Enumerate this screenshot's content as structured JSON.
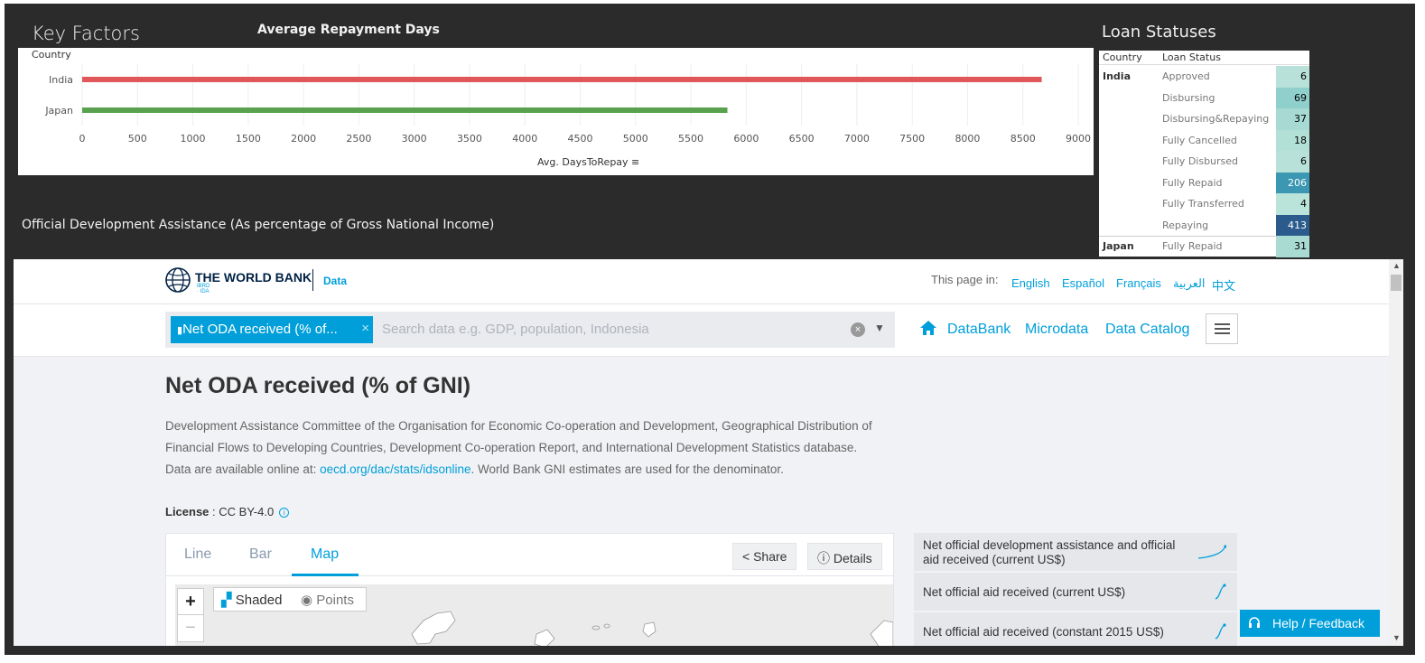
{
  "dashboard": {
    "key_factors_title": "Key Factors",
    "bar_chart_title": "Average Repayment Days",
    "loan_title": "Loan Statuses",
    "oda_title": "Official Development Assistance (As percentage of Gross National Income)"
  },
  "chart_data": {
    "type": "bar",
    "orientation": "horizontal",
    "title": "Average Repayment Days",
    "ylabel": "Country",
    "xlabel": "Avg. DaysToRepay",
    "categories": [
      "India",
      "Japan"
    ],
    "values": [
      8670,
      5830
    ],
    "colors": [
      "#e15759",
      "#59a14f"
    ],
    "xlim": [
      0,
      9000
    ],
    "xticks": [
      0,
      500,
      1000,
      1500,
      2000,
      2500,
      3000,
      3500,
      4000,
      4500,
      5000,
      5500,
      6000,
      6500,
      7000,
      7500,
      8000,
      8500,
      9000
    ],
    "grid": true
  },
  "loan_table": {
    "headers": [
      "Country",
      "Loan Status"
    ],
    "rows": [
      {
        "country": "India",
        "status": "Approved",
        "value": "6",
        "bg": "#b8e2d9",
        "fg": "#000"
      },
      {
        "country": "",
        "status": "Disbursing",
        "value": "69",
        "bg": "#8fcfcc",
        "fg": "#000"
      },
      {
        "country": "",
        "status": "Disbursing&Repaying",
        "value": "37",
        "bg": "#a6dad2",
        "fg": "#000"
      },
      {
        "country": "",
        "status": "Fully Cancelled",
        "value": "18",
        "bg": "#b2dfd6",
        "fg": "#000"
      },
      {
        "country": "",
        "status": "Fully Disbursed",
        "value": "6",
        "bg": "#b8e2d9",
        "fg": "#000"
      },
      {
        "country": "",
        "status": "Fully Repaid",
        "value": "206",
        "bg": "#3b97b2",
        "fg": "#fff"
      },
      {
        "country": "",
        "status": "Fully Transferred",
        "value": "4",
        "bg": "#bae3da",
        "fg": "#000"
      },
      {
        "country": "",
        "status": "Repaying",
        "value": "413",
        "bg": "#2b5a8c",
        "fg": "#fff"
      },
      {
        "country": "Japan",
        "status": "Fully Repaid",
        "value": "31",
        "bg": "#a9dbd3",
        "fg": "#000"
      }
    ]
  },
  "web": {
    "logo_text": "THE WORLD BANK",
    "logo_sub": "IBRD · IDA",
    "logo_data": "Data",
    "lang_label": "This page in:",
    "languages": [
      "English",
      "Español",
      "Français",
      "العربية",
      "中文"
    ],
    "search_chip": "Net ODA received (% of...",
    "search_placeholder": "Search data e.g. GDP, population, Indonesia",
    "nav": [
      "DataBank",
      "Microdata",
      "Data Catalog"
    ],
    "page_title": "Net ODA received (% of GNI)",
    "desc_before": "Development Assistance Committee of the Organisation for Economic Co-operation and Development, Geographical Distribution of Financial Flows to Developing Countries, Development Co-operation Report, and International Development Statistics database. Data are available online at: ",
    "desc_link": "oecd.org/dac/stats/idsonline",
    "desc_after": ". World Bank GNI estimates are used for the denominator.",
    "license_label": "License",
    "license_value": " : CC BY-4.0",
    "tabs": [
      "Line",
      "Bar",
      "Map"
    ],
    "share_label": "Share",
    "details_label": "Details",
    "map_shaded": "Shaded",
    "map_points": "Points",
    "related": [
      "Net official development assistance and official aid received (current US$)",
      "Net official aid received (current US$)",
      "Net official aid received (constant 2015 US$)"
    ],
    "help_label": "Help / Feedback",
    "accent_color": "#009fda"
  }
}
